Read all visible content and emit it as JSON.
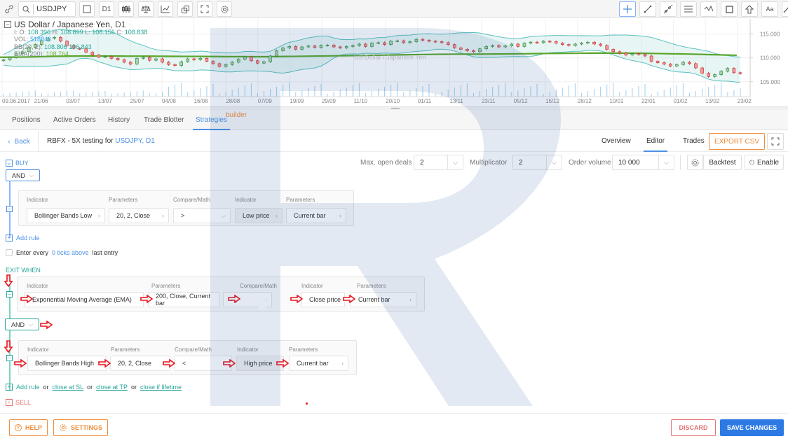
{
  "toolbar": {
    "symbol_value": "USDJPY",
    "timeframe_label": "D1",
    "left_icons": [
      "link-icon",
      "search-icon",
      "square-icon",
      "timeframe",
      "candles-icon",
      "scales-icon",
      "indicators-icon",
      "layers-icon",
      "fullscreen-icon",
      "settings-icon"
    ],
    "right_icons": [
      "crosshair-icon",
      "trendline-icon",
      "ray-icon",
      "horizontal-lines-icon",
      "pattern-icon",
      "rectangle-icon",
      "arrow-up-icon",
      "text-icon",
      "brush-icon"
    ],
    "text_tool_label": "Aa"
  },
  "chart": {
    "title": "US Dollar / Japanese Yen,",
    "timeframe": "D1",
    "ohlc": {
      "o_label": "I: O:",
      "o": "108.396",
      "h_label": "H:",
      "h": "108.899",
      "l_label": "L:",
      "l": "108.156",
      "c_label": "C:",
      "c": "108.838"
    },
    "vol_label": "VOL:",
    "vol": "518846",
    "bb_label": "BB(20, 2):",
    "bb": "108.806 106.843",
    "ema_label": "EMA(200):",
    "ema": "108.764",
    "watermark": "USDJPY, D1",
    "watermark_sub": "US Dollar / Japanese Yen",
    "colors": {
      "up": "#4caf50",
      "down": "#e57373",
      "band": "#5bc0be",
      "ema": "#5aa52a",
      "volume": "#9ecff0"
    }
  },
  "chart_data": {
    "type": "candlestick",
    "title": "US Dollar / Japanese Yen, D1",
    "xlabel": "",
    "ylabel": "",
    "x_ticks": [
      "09.06.2017",
      "21/06",
      "03/07",
      "13/07",
      "25/07",
      "04/08",
      "16/08",
      "28/08",
      "07/09",
      "19/09",
      "29/09",
      "11/10",
      "20/10",
      "01/11",
      "13/11",
      "23/11",
      "05/12",
      "15/12",
      "28/12",
      "10/01",
      "22/01",
      "01/02",
      "13/02",
      "23/02"
    ],
    "y_ticks": [
      "115.000",
      "110.000",
      "105.000"
    ],
    "ylim": [
      103.5,
      117
    ],
    "close_series": [
      109.6,
      110.1,
      110.9,
      111.3,
      112.2,
      112.8,
      113.6,
      114.1,
      114.3,
      113.5,
      112.6,
      112.0,
      111.9,
      111.2,
      110.6,
      110.2,
      110.3,
      109.9,
      109.6,
      109.1,
      108.7,
      109.9,
      110.1,
      109.5,
      109.8,
      109.1,
      108.6,
      108.4,
      109.2,
      109.8,
      109.6,
      109.9,
      109.3,
      108.8,
      108.2,
      108.6,
      109.1,
      109.7,
      110.2,
      109.4,
      108.9,
      109.2,
      110.4,
      111.5,
      112.1,
      112.4,
      111.8,
      112.3,
      112.5,
      112.2,
      112.6,
      112.7,
      112.3,
      112.1,
      112.4,
      112.6,
      112.9,
      112.4,
      113.1,
      113.2,
      112.8,
      113.5,
      113.6,
      113.2,
      113.4,
      113.9,
      113.7,
      113.5,
      113.4,
      113.2,
      112.8,
      112.1,
      111.8,
      111.5,
      111.3,
      111.9,
      112.4,
      112.6,
      112.3,
      112.5,
      112.9,
      112.4,
      113.1,
      113.3,
      113.2,
      113.5,
      113.4,
      113.1,
      112.8,
      112.6,
      112.9,
      113.1,
      113.3,
      112.9,
      112.6,
      111.8,
      111.3,
      111.0,
      110.6,
      110.9,
      110.7,
      110.4,
      109.3,
      109.0,
      108.7,
      108.3,
      108.6,
      109.1,
      108.8,
      107.9,
      106.8,
      106.1,
      106.5,
      107.2,
      107.8,
      106.9,
      106.7
    ],
    "ema200_value": 108.764,
    "bb_upper_last": 108.806,
    "bb_lower_last": 106.843,
    "last_ohlc": {
      "open": 108.396,
      "high": 108.899,
      "low": 108.156,
      "close": 108.838
    },
    "last_volume": 518846
  },
  "tabs": [
    {
      "label": "Positions",
      "active": false
    },
    {
      "label": "Active Orders",
      "active": false
    },
    {
      "label": "History",
      "active": false
    },
    {
      "label": "Trade Blotter",
      "active": false
    },
    {
      "label": "Strategies",
      "active": true
    }
  ],
  "builder_note": "builder",
  "strategy": {
    "back_label": "Back",
    "title_prefix": "RBFX - 5X testing for",
    "title_symbol": "USDJPY, D1",
    "view_tabs": [
      {
        "label": "Overview",
        "active": false
      },
      {
        "label": "Editor",
        "active": true
      },
      {
        "label": "Trades",
        "active": false
      }
    ],
    "export_label": "EXPORT CSV",
    "max_open_deals_label": "Max. open deals",
    "max_open_deals_value": "2",
    "multiplicator_label": "Multiplicator",
    "multiplicator_value": "2",
    "order_volume_label": "Order volume",
    "order_volume_value": "10 000",
    "backtest_label": "Backtest",
    "enable_label": "Enable"
  },
  "buy": {
    "label": "BUY",
    "logic": "AND",
    "rules": [
      {
        "labels": [
          "Indicator",
          "Parameters",
          "Compare/Math",
          "Indicator",
          "Parameters"
        ],
        "indicator": "Bollinger Bands Low",
        "parameters": "20, 2, Close",
        "compare": ">",
        "indicator2": "Low price",
        "parameters2": "Current bar"
      }
    ],
    "add_rule_label": "Add rule",
    "entry_prefix": "Enter every",
    "entry_link": "0 ticks above",
    "entry_suffix": "last entry"
  },
  "exit": {
    "label": "EXIT WHEN",
    "logic": "AND",
    "rules": [
      {
        "labels": [
          "Indicator",
          "Parameters",
          "Compare/Math",
          "Indicator",
          "Parameters"
        ],
        "indicator": "Exponential Moving Average (EMA)",
        "parameters": "200, Close, Current bar",
        "compare": ">",
        "indicator2": "Close price",
        "parameters2": "Current bar"
      },
      {
        "labels": [
          "Indicator",
          "Parameters",
          "Compare/Math",
          "Indicator",
          "Parameters"
        ],
        "indicator": "Bollinger Bands High",
        "parameters": "20, 2, Close",
        "compare": "<",
        "indicator2": "High price",
        "parameters2": "Current bar"
      }
    ],
    "add_rule_label": "Add rule",
    "or1": "or",
    "close_sl": "close at SL",
    "or2": "or",
    "close_tp": "close at TP",
    "or3": "or",
    "close_lifetime": "close if lifetime"
  },
  "sell": {
    "label": "SELL"
  },
  "footer": {
    "help_label": "HELP",
    "settings_label": "SETTINGS",
    "discard_label": "DISCARD",
    "save_label": "SAVE CHANGES"
  },
  "colors": {
    "accent": "#4a90e2",
    "orange": "#f08c3a",
    "exit_green": "#26a69a",
    "sell_red": "#e57373",
    "save_blue": "#2d7ae5",
    "annotation_red": "#e8141c"
  }
}
